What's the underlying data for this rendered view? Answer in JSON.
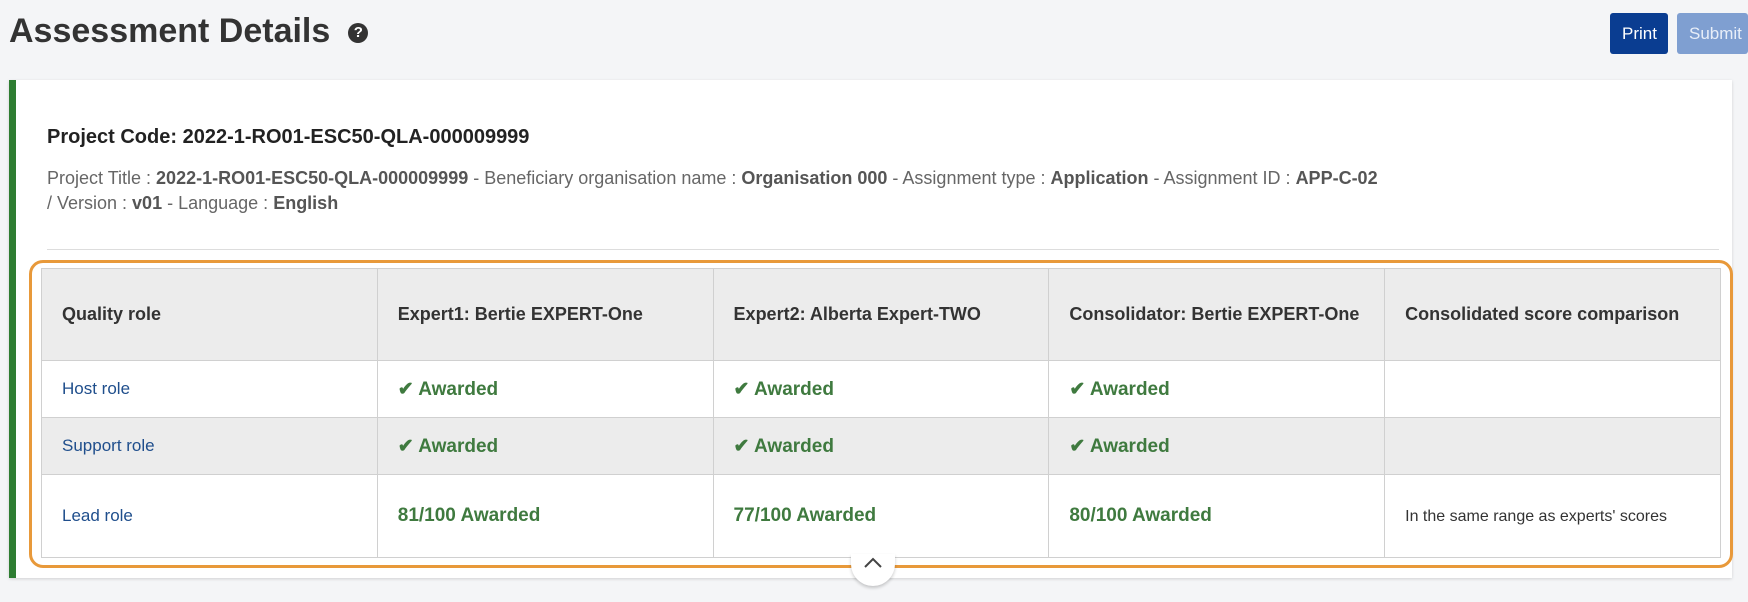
{
  "header": {
    "title": "Assessment Details",
    "help_icon": "?",
    "print_label": "Print",
    "submit_label": "Submit"
  },
  "project": {
    "code_line": "Project Code: 2022-1-RO01-ESC50-QLA-000009999",
    "title_label": "Project Title : ",
    "title_value": "2022-1-RO01-ESC50-QLA-000009999",
    "org_label": " - Beneficiary organisation name : ",
    "org_value": "Organisation 000",
    "type_label": " - Assignment type : ",
    "type_value": "Application",
    "id_label": " - Assignment ID : ",
    "id_value": "APP-C-02",
    "version_label": " / Version : ",
    "version_value": "v01",
    "language_label": " - Language : ",
    "language_value": "English"
  },
  "table": {
    "headers": [
      "Quality role",
      "Expert1: Bertie EXPERT-One",
      "Expert2: Alberta Expert-TWO",
      "Consolidator: Bertie EXPERT-One",
      "Consolidated score comparison"
    ],
    "rows": [
      {
        "role": "Host role",
        "expert1": "✔ Awarded",
        "expert2": "✔ Awarded",
        "consolidator": "✔ Awarded",
        "comparison": ""
      },
      {
        "role": "Support role",
        "expert1": "✔ Awarded",
        "expert2": "✔ Awarded",
        "consolidator": "✔ Awarded",
        "comparison": ""
      },
      {
        "role": "Lead role",
        "expert1": "81/100 Awarded",
        "expert2": "77/100 Awarded",
        "consolidator": "80/100 Awarded",
        "comparison": "In the same range as experts' scores"
      }
    ]
  },
  "collapse_icon": "chevron-up-icon",
  "colors": {
    "accent_green": "#2e7d32",
    "highlight_orange": "#e8993a",
    "print_button": "#0a3d91",
    "submit_button": "#7f9fd1",
    "awarded_text": "#3f7a3f"
  }
}
